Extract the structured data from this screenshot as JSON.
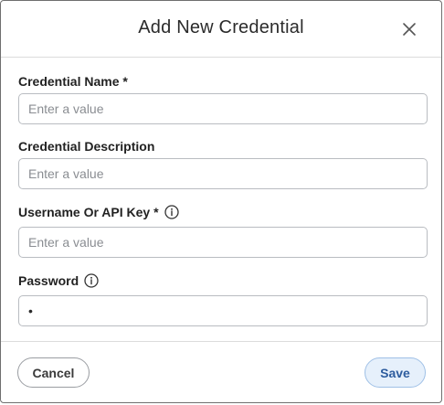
{
  "dialog": {
    "title": "Add New Credential",
    "close_icon": "close-icon"
  },
  "fields": [
    {
      "label": "Credential Name *",
      "placeholder": "Enter a value",
      "value": "",
      "info_icon": false
    },
    {
      "label": "Credential Description",
      "placeholder": "Enter a value",
      "value": "",
      "info_icon": false
    },
    {
      "label": "Username Or API Key *",
      "placeholder": "Enter a value",
      "value": "",
      "info_icon": "info-icon"
    },
    {
      "label": "Password",
      "placeholder": "",
      "value": "•",
      "info_icon": "info-icon"
    }
  ],
  "footer": {
    "cancel_label": "Cancel",
    "save_label": "Save"
  },
  "colors": {
    "save_bg": "#e6f0fb",
    "save_text": "#2d5c9e",
    "border": "#b9bcc1"
  }
}
